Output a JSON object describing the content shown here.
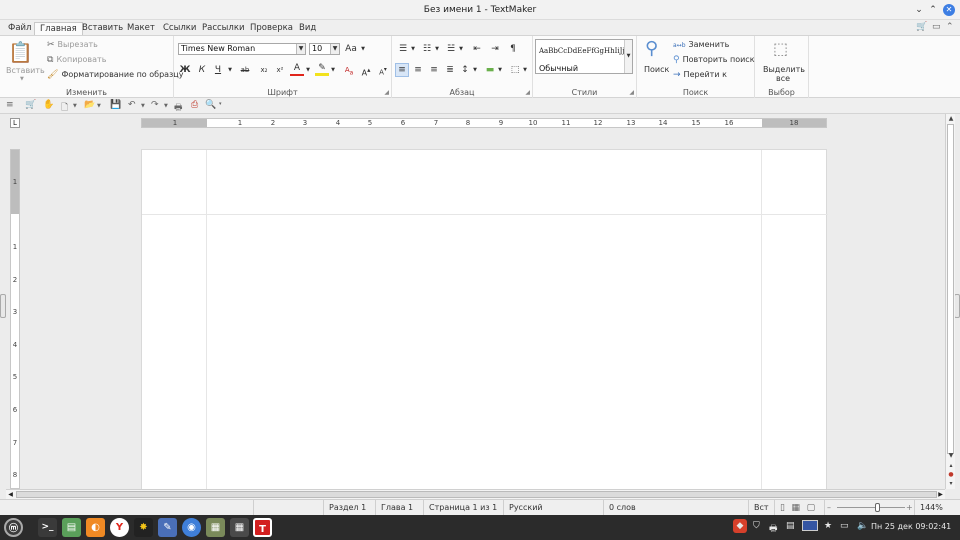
{
  "window": {
    "title": "Без имени 1 - TextMaker",
    "minimize": "⌄",
    "maximize": "⌃",
    "close": "✕"
  },
  "menu": {
    "tabs": [
      "Файл",
      "Главная",
      "Вставить",
      "Макет",
      "Ссылки",
      "Рассылки",
      "Проверка",
      "Вид"
    ],
    "active_index": 1
  },
  "ribbon": {
    "edit": {
      "paste": "Вставить",
      "cut": "Вырезать",
      "copy": "Копировать",
      "format_painter": "Форматирование по образцу",
      "label": "Изменить"
    },
    "font": {
      "name": "Times New Roman",
      "size": "10",
      "bold": "Ж",
      "italic": "К",
      "underline": "Ч",
      "strike": "ab",
      "subscript": "x₂",
      "superscript": "x²",
      "font_color_letter": "A",
      "label": "Шрифт"
    },
    "paragraph": {
      "label": "Абзац"
    },
    "styles": {
      "sample": "AaBbCcDdEeFfGgHhIiJj",
      "current": "Обычный",
      "label": "Стили"
    },
    "search": {
      "find": "Поиск",
      "replace": "Заменить",
      "repeat": "Повторить поиск",
      "goto": "Перейти к",
      "label": "Поиск"
    },
    "select": {
      "select_all_line1": "Выделить",
      "select_all_line2": "все",
      "label": "Выбор"
    }
  },
  "ruler": {
    "tab_marker": "L",
    "h_numbers": [
      "1",
      "1",
      "2",
      "3",
      "4",
      "5",
      "6",
      "7",
      "8",
      "9",
      "10",
      "11",
      "12",
      "13",
      "14",
      "15",
      "16",
      "18"
    ],
    "v_numbers": [
      "1",
      "1",
      "2",
      "3",
      "4",
      "5",
      "6",
      "7",
      "8"
    ]
  },
  "statusbar": {
    "section": "Раздел 1",
    "chapter": "Глава 1",
    "page": "Страница 1 из 1",
    "language": "Русский",
    "words": "0 слов",
    "mode": "Вст",
    "zoom": "144%",
    "zoom_level": 0.6
  },
  "taskbar": {
    "datetime": "Пн 25 дек  09:02:41"
  }
}
